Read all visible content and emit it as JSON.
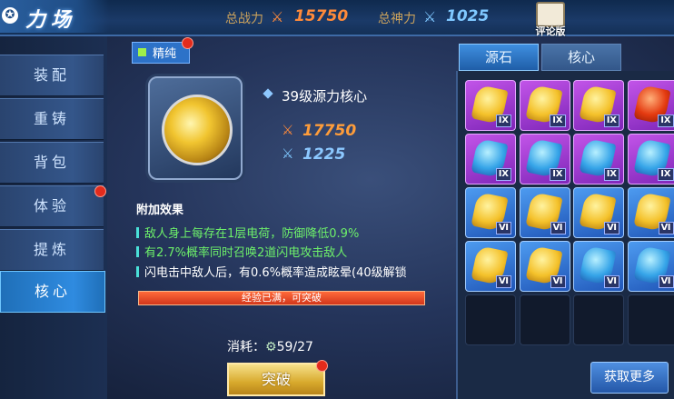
{
  "header": {
    "title_icon": "✪",
    "title": "力场",
    "total_power_label": "总战力",
    "total_power_value": "15750",
    "total_spirit_label": "总神力",
    "total_spirit_value": "1025",
    "review_label": "评论版",
    "colors": {
      "power": "#ff8a3a",
      "spirit": "#7fc8ff"
    }
  },
  "nav": {
    "items": [
      {
        "label": "装配"
      },
      {
        "label": "重铸"
      },
      {
        "label": "背包"
      },
      {
        "label": "体验"
      },
      {
        "label": "提炼"
      },
      {
        "label": "核心"
      }
    ],
    "active": "核心"
  },
  "item": {
    "quality_label": "精纯",
    "name": "39级源力核心",
    "power_value": "17750",
    "spirit_value": "1225"
  },
  "effects": {
    "title": "附加效果",
    "lines": [
      {
        "text": "敌人身上每存在1层电荷，防御降低0.9%",
        "color": "#6df06a"
      },
      {
        "text": "有2.7%概率同时召唤2道闪电攻击敌人",
        "color": "#6df06a"
      },
      {
        "text": "闪电击中敌人后，有0.6%概率造成眩晕(40级解锁",
        "color": "#ffffff"
      }
    ]
  },
  "progress": {
    "text": "经验已满，可突破",
    "fraction": 1.0
  },
  "cost": {
    "label": "消耗：",
    "value": "59/27"
  },
  "break_button": "突破",
  "right_panel": {
    "tabs": [
      {
        "label": "源石"
      },
      {
        "label": "核心"
      }
    ],
    "active_tab": "源石",
    "get_more_button": "获取更多",
    "slots": [
      [
        {
          "color": "purple",
          "gem": "gold",
          "grade": "Ⅸ"
        },
        {
          "color": "purple",
          "gem": "gold",
          "grade": "Ⅸ"
        },
        {
          "color": "purple",
          "gem": "gold",
          "grade": "Ⅸ"
        },
        {
          "color": "purple",
          "gem": "red",
          "grade": "Ⅸ"
        }
      ],
      [
        {
          "color": "purple",
          "gem": "teal",
          "grade": "Ⅸ"
        },
        {
          "color": "purple",
          "gem": "teal",
          "grade": "Ⅸ"
        },
        {
          "color": "purple",
          "gem": "teal",
          "grade": "Ⅸ"
        },
        {
          "color": "purple",
          "gem": "teal",
          "grade": "Ⅸ"
        }
      ],
      [
        {
          "color": "blue",
          "gem": "gold",
          "grade": "Ⅵ"
        },
        {
          "color": "blue",
          "gem": "gold",
          "grade": "Ⅵ"
        },
        {
          "color": "blue",
          "gem": "gold",
          "grade": "Ⅵ"
        },
        {
          "color": "blue",
          "gem": "gold",
          "grade": "Ⅵ"
        }
      ],
      [
        {
          "color": "blue",
          "gem": "gold",
          "grade": "Ⅵ"
        },
        {
          "color": "blue",
          "gem": "gold",
          "grade": "Ⅵ"
        },
        {
          "color": "blue",
          "gem": "teal",
          "grade": "Ⅵ"
        },
        {
          "color": "blue",
          "gem": "teal",
          "grade": "Ⅵ"
        }
      ],
      [
        {
          "color": "empty"
        },
        {
          "color": "empty"
        },
        {
          "color": "empty"
        },
        {
          "color": "empty"
        }
      ]
    ]
  }
}
